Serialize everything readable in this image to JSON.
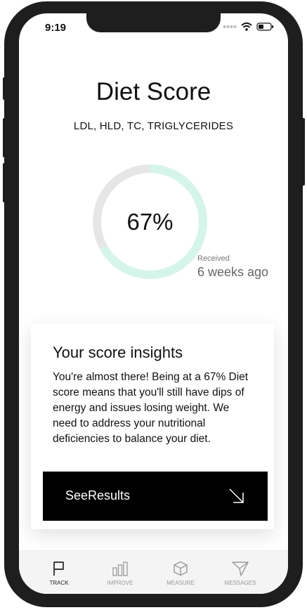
{
  "status": {
    "time": "9:19"
  },
  "header": {
    "title": "Diet Score",
    "subtitle": "LDL, HLD, TC, TRIGLYCERIDES"
  },
  "score": {
    "percent_label": "67%",
    "fraction": 0.67,
    "received_label": "Received",
    "received_value": "6 weeks ago",
    "progress_color": "#d5f5ea",
    "track_color": "#e6e6e6"
  },
  "insights": {
    "title": "Your score insights",
    "body": "You're almost there! Being at a 67% Diet score means that you'll still have dips of energy and issues losing weight. We need to address your nutritional deficiencies to balance your diet."
  },
  "cta": {
    "label": "SeeResults",
    "icon": "arrow-down-right-icon"
  },
  "tabs": [
    {
      "label": "TRACK",
      "icon": "flag-icon",
      "active": true
    },
    {
      "label": "IMPROVE",
      "icon": "bar-chart-icon",
      "active": false
    },
    {
      "label": "MEASURE",
      "icon": "cube-icon",
      "active": false
    },
    {
      "label": "MESSAGES",
      "icon": "send-icon",
      "active": false
    }
  ]
}
